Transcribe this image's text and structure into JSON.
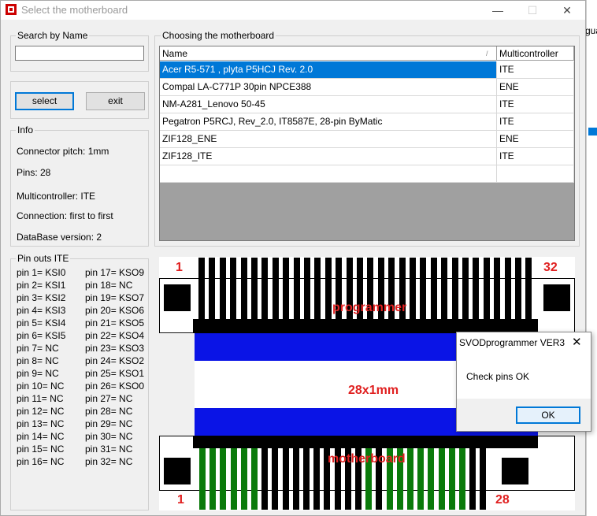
{
  "window": {
    "title": "Select the motherboard",
    "buttons": {
      "minimize": "—",
      "maximize": "☐",
      "close": "✕"
    }
  },
  "background_peek": "gua",
  "search": {
    "label": "Search by Name",
    "value": ""
  },
  "actions": {
    "select_label": "select",
    "exit_label": "exit"
  },
  "info": {
    "label": "Info",
    "connector_pitch": "Connector pitch: 1mm",
    "pins": "Pins: 28",
    "multicontroller": "Multicontroller: ITE",
    "connection": "Connection: first to first",
    "database_version": "DataBase version: 2"
  },
  "board_table": {
    "label": "Choosing the motherboard",
    "columns": [
      "Name",
      "Multicontroller"
    ],
    "sort_glyph": "/",
    "rows": [
      {
        "name": "Acer R5-571 , plyta P5HCJ Rev. 2.0",
        "mc": "ITE",
        "selected": true
      },
      {
        "name": "Compal LA-C771P 30pin  NPCE388",
        "mc": "ENE",
        "selected": false
      },
      {
        "name": "NM-A281_Lenovo 50-45",
        "mc": "ITE",
        "selected": false
      },
      {
        "name": "Pegatron P5RCJ, Rev_2.0, IT8587E, 28-pin ByMatic",
        "mc": "ITE",
        "selected": false
      },
      {
        "name": "ZIF128_ENE",
        "mc": "ENE",
        "selected": false
      },
      {
        "name": "ZIF128_ITE",
        "mc": "ITE",
        "selected": false
      },
      {
        "name": "",
        "mc": "",
        "selected": false
      }
    ]
  },
  "pinouts": {
    "label": "Pin outs ITE",
    "left": [
      "pin 1= KSI0",
      "pin 2= KSI1",
      "pin 3= KSI2",
      "pin 4= KSI3",
      "pin 5= KSI4",
      "pin 6= KSI5",
      "pin 7= NC",
      "pin 8= NC",
      "pin 9= NC",
      "pin 10= NC",
      "pin 11= NC",
      "pin 12= NC",
      "pin 13= NC",
      "pin 14= NC",
      "pin 15= NC",
      "pin 16= NC"
    ],
    "right": [
      "pin 17= KSO9",
      "pin 18= NC",
      "pin 19= KSO7",
      "pin 20= KSO6",
      "pin 21= KSO5",
      "pin 22= KSO4",
      "pin 23= KSO3",
      "pin 24= KSO2",
      "pin 25= KSO1",
      "pin 26= KSO0",
      "pin 27= NC",
      "pin 28= NC",
      "pin 29= NC",
      "pin 30= NC",
      "pin 31= NC",
      "pin 32= NC"
    ]
  },
  "diagram": {
    "programmer_label": "programmer",
    "programmer_pin_first": "1",
    "programmer_pin_last": "32",
    "cable_label": "28x1mm",
    "motherboard_label": "motherboard",
    "motherboard_pin_first": "1",
    "motherboard_pin_last": "28",
    "colors": {
      "red": "#e02020",
      "blue": "#0a14e6",
      "green": "#0a7a0a",
      "black": "#000000"
    }
  },
  "dialog": {
    "title": "SVODprogrammer VER3",
    "message": "Check pins OK",
    "ok_label": "OK",
    "close_glyph": "✕"
  }
}
